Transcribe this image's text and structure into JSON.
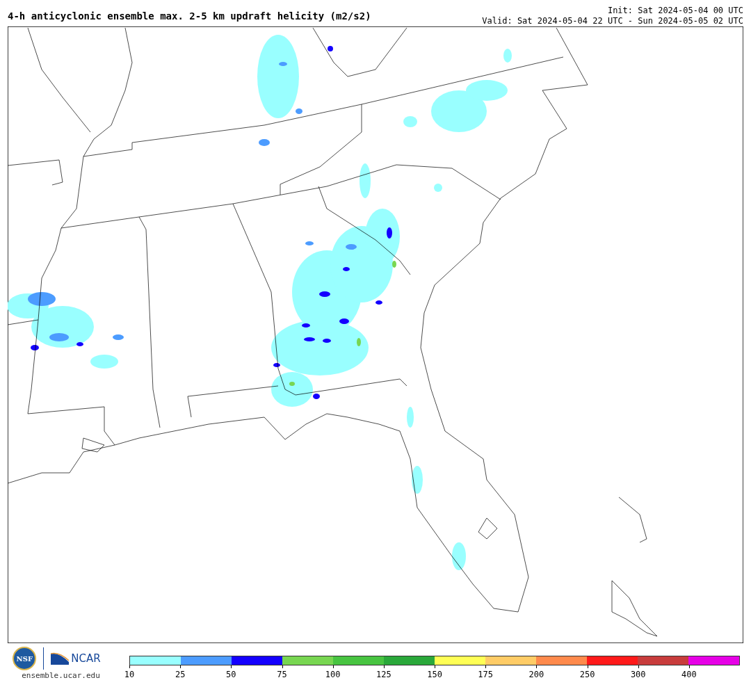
{
  "title": "4-h anticyclonic ensemble max. 2-5 km updraft helicity (m2/s2)",
  "init": "Init: Sat 2024-05-04 00 UTC",
  "valid": "Valid: Sat 2024-05-04 22 UTC - Sun 2024-05-05 02 UTC",
  "logos": {
    "nsf": "NSF",
    "ncar": "NCAR",
    "url": "ensemble.ucar.edu"
  },
  "colorbar": [
    {
      "label": "10",
      "color": "#99ffff"
    },
    {
      "label": "25",
      "color": "#4c9cff"
    },
    {
      "label": "50",
      "color": "#1400ff"
    },
    {
      "label": "75",
      "color": "#78d651"
    },
    {
      "label": "100",
      "color": "#48c441"
    },
    {
      "label": "125",
      "color": "#2aa83a"
    },
    {
      "label": "150",
      "color": "#ffff55"
    },
    {
      "label": "175",
      "color": "#ffcc66"
    },
    {
      "label": "200",
      "color": "#ff8a4c"
    },
    {
      "label": "250",
      "color": "#ff1a1a"
    },
    {
      "label": "300",
      "color": "#c83c3c"
    },
    {
      "label": "400",
      "color": "#e600e6"
    }
  ]
}
